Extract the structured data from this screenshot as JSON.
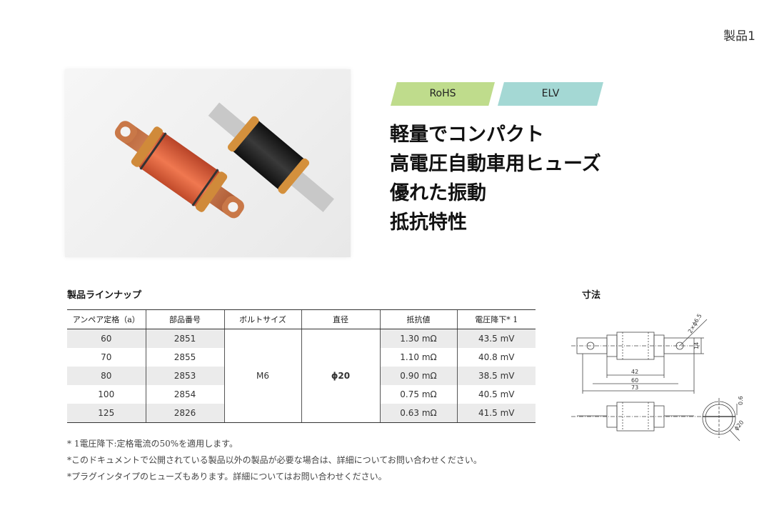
{
  "page_label": "製品1",
  "badges": {
    "rohs": "RoHS",
    "elv": "ELV"
  },
  "headline": [
    "軽量でコンパクト",
    "高電圧自動車用ヒューズ",
    "優れた振動",
    "抵抗特性"
  ],
  "lineup": {
    "title": "製品ラインナップ",
    "headers": [
      "アンペア定格（a）",
      "部品番号",
      "ボルトサイズ",
      "直径",
      "抵抗値",
      "電圧降下* 1"
    ],
    "bolt_size": "M6",
    "diameter": "ϕ20",
    "rows": [
      {
        "ampere": "60",
        "part": "2851",
        "resistance": "1.30 mΩ",
        "drop": "43.5 mV"
      },
      {
        "ampere": "70",
        "part": "2855",
        "resistance": "1.10 mΩ",
        "drop": "40.8 mV"
      },
      {
        "ampere": "80",
        "part": "2853",
        "resistance": "0.90 mΩ",
        "drop": "38.5 mV"
      },
      {
        "ampere": "100",
        "part": "2854",
        "resistance": "0.75 mΩ",
        "drop": "40.5 mV"
      },
      {
        "ampere": "125",
        "part": "2826",
        "resistance": "0.63 mΩ",
        "drop": "41.5 mV"
      }
    ]
  },
  "dimensions": {
    "title": "寸法",
    "labels": {
      "hole": "2×ϕ6.5",
      "height": "14",
      "d42": "42",
      "d60": "60",
      "d73": "73",
      "t": "0.6",
      "dia": "ϕ20"
    }
  },
  "notes": [
    "* 1電圧降下:定格電流の50%を適用します。",
    "*このドキュメントで公開されている製品以外の製品が必要な場合は、詳細についてお問い合わせください。",
    "*プラグインタイプのヒューズもあります。詳細についてはお問い合わせください。"
  ],
  "colors": {
    "rohs": "#bfdc8c",
    "elv": "#a4d8d4",
    "row_shade": "#ebebeb"
  }
}
